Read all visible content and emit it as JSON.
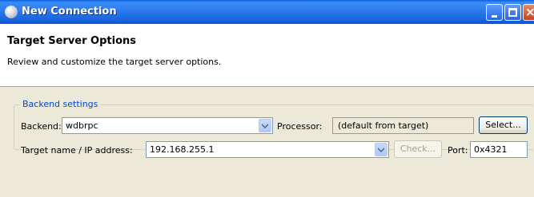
{
  "window": {
    "title": "New Connection"
  },
  "header": {
    "title": "Target Server Options",
    "description": "Review and customize the target server options."
  },
  "backend_group": {
    "legend": "Backend settings",
    "backend_label": "Backend:",
    "backend_value": "wdbrpc",
    "processor_label": "Processor:",
    "processor_value": "(default from target)",
    "select_button": "Select...",
    "target_label": "Target name / IP address:",
    "target_value": "192.168.255.1",
    "check_button": "Check...",
    "port_label": "Port:",
    "port_value": "0x4321"
  },
  "icons": {
    "window_icon": "app-icon",
    "dropdown": "chevron-down-icon"
  },
  "colors": {
    "titlebar": "#2f7ef0",
    "legend_text": "#0046d5",
    "dialog_bg": "#ece9d8"
  }
}
